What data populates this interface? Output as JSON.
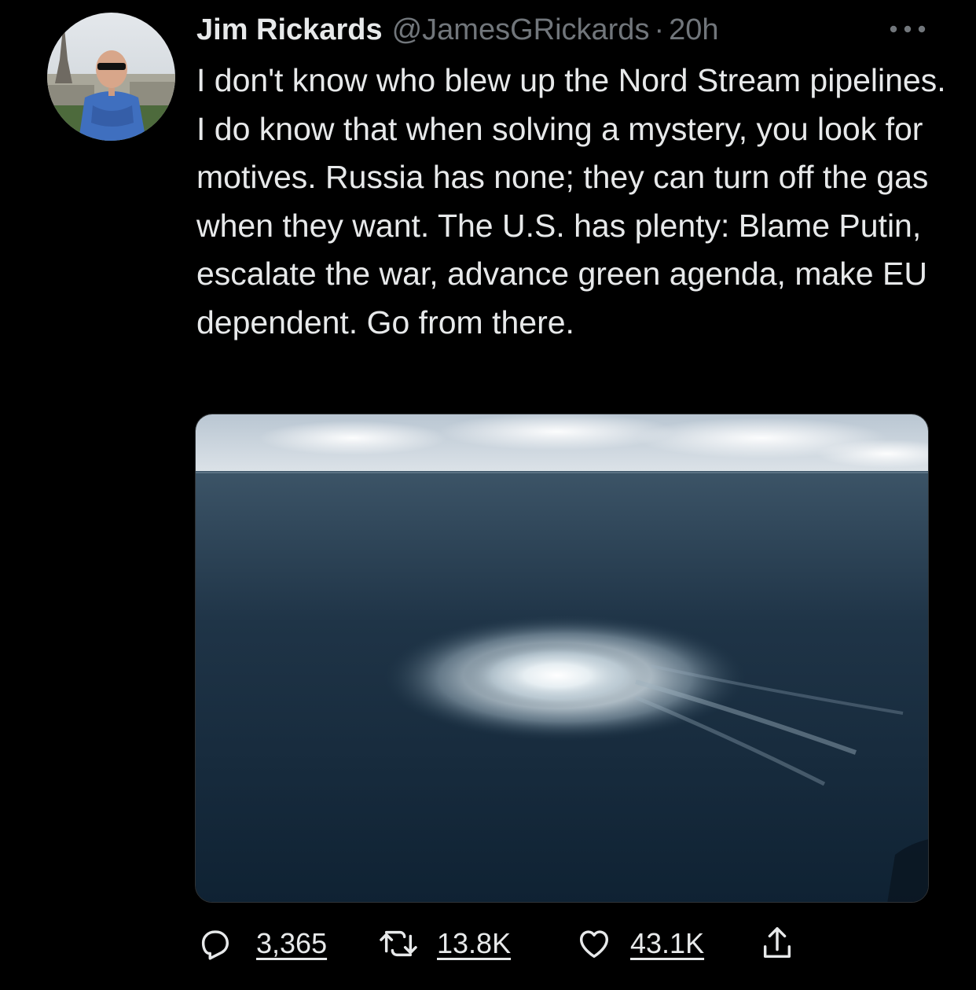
{
  "tweet": {
    "author": {
      "name": "Jim Rickards",
      "handle": "@JamesGRickards",
      "separator": "·",
      "time": "20h",
      "avatar": "avatar-photo"
    },
    "text": "I don't know who blew up the Nord Stream pipelines. I do know that when solving a mystery, you look for motives. Russia has none; they can turn off the gas when they want. The U.S. has plenty: Blame Putin, escalate the war, advance green agenda, make EU dependent. Go from there.",
    "media": {
      "icon": "photo-sea-gas-leak"
    },
    "actions": {
      "reply": {
        "icon": "reply-icon",
        "count": "3,365"
      },
      "retweet": {
        "icon": "retweet-icon",
        "count": "13.8K"
      },
      "like": {
        "icon": "heart-icon",
        "count": "43.1K"
      },
      "share": {
        "icon": "share-icon"
      }
    },
    "more_icon": "more-icon"
  },
  "colors": {
    "background": "#000000",
    "primary_text": "#e7e9ea",
    "secondary_text": "#71767b",
    "border": "#2f3336"
  }
}
